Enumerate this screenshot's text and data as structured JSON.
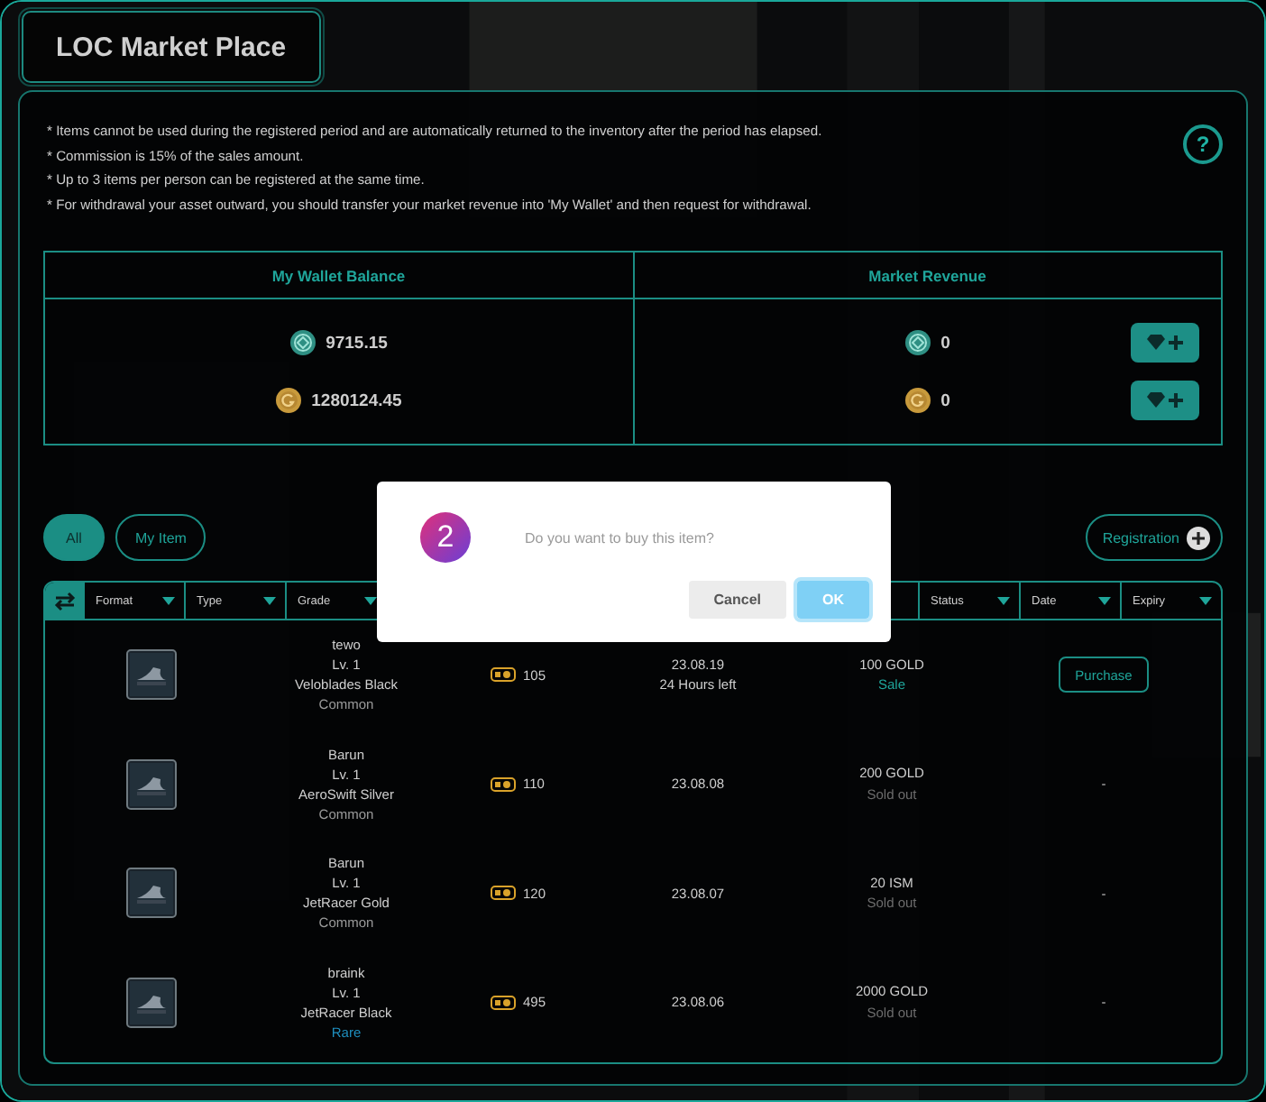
{
  "title": "LOC Market Place",
  "notes": [
    "* Items cannot be used during the registered period and are automatically returned to the inventory after the period has elapsed.",
    "* Commission is 15% of the sales amount.",
    "* Up to 3 items per person can be registered at the same time.",
    "* For withdrawal your asset outward, you should transfer your market revenue into 'My Wallet' and then request for withdrawal."
  ],
  "help_label": "?",
  "wallet": {
    "heading": "My Wallet Balance",
    "balances": [
      {
        "kind": "ism",
        "amount": "9715.15"
      },
      {
        "kind": "gold",
        "amount": "1280124.45"
      }
    ]
  },
  "revenue": {
    "heading": "Market Revenue",
    "balances": [
      {
        "kind": "ism",
        "amount": "0"
      },
      {
        "kind": "gold",
        "amount": "0"
      }
    ]
  },
  "filters": [
    {
      "label": "All",
      "selected": true
    },
    {
      "label": "My Item",
      "selected": false
    }
  ],
  "registration_label": "Registration",
  "columns": [
    {
      "label": "Format"
    },
    {
      "label": "Type"
    },
    {
      "label": "Grade"
    },
    {
      "label": "Status"
    },
    {
      "label": "Date"
    },
    {
      "label": "Expiry"
    }
  ],
  "rows": [
    {
      "seller": "tewo",
      "level": "Lv. 1",
      "item": "Veloblades Black",
      "grade": "Common",
      "rare": false,
      "power": "105",
      "date": "23.08.19",
      "remaining": "24 Hours left",
      "price": "100 GOLD",
      "status": {
        "text": "Sale",
        "kind": "sale"
      },
      "action": {
        "kind": "button",
        "label": "Purchase"
      }
    },
    {
      "seller": "Barun",
      "level": "Lv. 1",
      "item": "AeroSwift Silver",
      "grade": "Common",
      "rare": false,
      "power": "110",
      "date": "23.08.08",
      "price": "200 GOLD",
      "status": {
        "text": "Sold out",
        "kind": "sold"
      },
      "action": {
        "kind": "text",
        "label": "-"
      }
    },
    {
      "seller": "Barun",
      "level": "Lv. 1",
      "item": "JetRacer Gold",
      "grade": "Common",
      "rare": false,
      "power": "120",
      "date": "23.08.07",
      "price": "20 ISM",
      "status": {
        "text": "Sold out",
        "kind": "sold"
      },
      "action": {
        "kind": "text",
        "label": "-"
      }
    },
    {
      "seller": "braink",
      "level": "Lv. 1",
      "item": "JetRacer Black",
      "grade": "Rare",
      "rare": true,
      "power": "495",
      "date": "23.08.06",
      "price": "2000 GOLD",
      "status": {
        "text": "Sold out",
        "kind": "sold"
      },
      "action": {
        "kind": "text",
        "label": "-"
      }
    }
  ],
  "dialog": {
    "step": "2",
    "message": "Do you want to buy this item?",
    "buttons": [
      {
        "label": "Cancel",
        "selected": false
      },
      {
        "label": "OK",
        "selected": true
      }
    ]
  }
}
